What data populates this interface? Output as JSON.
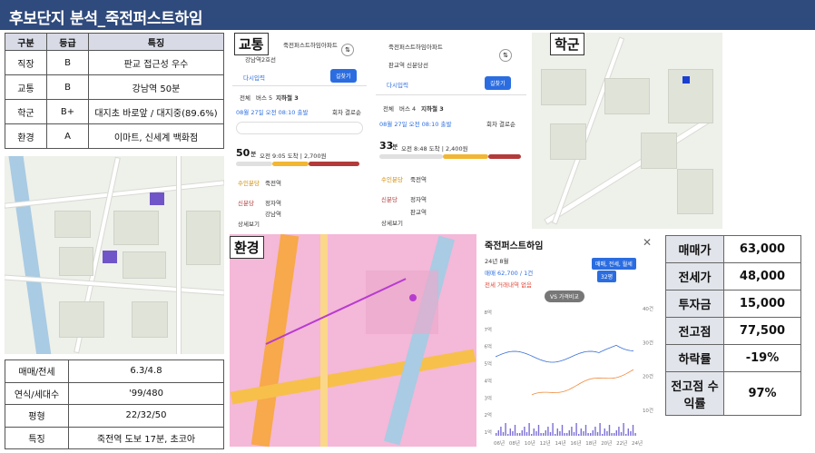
{
  "title": "후보단지 분석_죽전퍼스트하임",
  "grades_table": {
    "headers": [
      "구분",
      "등급",
      "특징"
    ],
    "rows": [
      [
        "직장",
        "B",
        "판교 접근성 우수"
      ],
      [
        "교통",
        "B",
        "강남역 50분"
      ],
      [
        "학군",
        "B+",
        "대지초 바로앞 / 대지중(89.6%)"
      ],
      [
        "환경",
        "A",
        "이마트, 신세계 백화점"
      ]
    ]
  },
  "info_table": {
    "rows": [
      [
        "매매/전세",
        "6.3/4.8"
      ],
      [
        "연식/세대수",
        "'99/480"
      ],
      [
        "평형",
        "22/32/50"
      ],
      [
        "특징",
        "죽전역 도보 17분, 초코아"
      ]
    ]
  },
  "labels": {
    "traffic": "교통",
    "school": "학군",
    "environment": "환경"
  },
  "route1": {
    "from": "죽전퍼스트하임아파트",
    "to": "강남역2호선",
    "reset": "다시입력",
    "go": "길찾기",
    "tabs": [
      "전체",
      "버스 5",
      "지하철 3"
    ],
    "date": "08월 27일 오전 08:10 출발",
    "opts": "회차 결로순",
    "minutes": "50",
    "minutes_unit": "분",
    "detail": "오전 9:05 도착 | 2,700원",
    "steps": [
      "수인분당",
      "죽전역",
      "신분당",
      "정자역",
      "강남역"
    ],
    "more": "상세보기"
  },
  "route2": {
    "from": "죽전퍼스트하임아파트",
    "to": "판교역 신분당선",
    "reset": "다시입력",
    "go": "길찾기",
    "tabs": [
      "전체",
      "버스 4",
      "지하철 3"
    ],
    "date": "08월 27일 오전 08:10 출발",
    "opts": "회차 결로순",
    "minutes": "33",
    "minutes_unit": "분",
    "detail": "오전 8:48 도착 | 2,400원",
    "steps": [
      "수인분당",
      "죽전역",
      "신분당",
      "정자역",
      "판교역"
    ],
    "more": "상세보기"
  },
  "price_panel": {
    "title": "죽전퍼스트하임",
    "month": "24년 8월",
    "sale": "매매 62,700 / 1건",
    "jeonse": "전세 거래내역 없음",
    "filter": "매매, 전세, 월세",
    "size": "32평",
    "compare": "VS 가격비교",
    "x_ticks": [
      "06년",
      "08년",
      "10년",
      "12년",
      "14년",
      "16년",
      "18년",
      "20년",
      "22년",
      "24년"
    ],
    "y_left": [
      "8억",
      "7억",
      "6억",
      "5억",
      "4억",
      "3억",
      "2억",
      "1억"
    ],
    "y_right": [
      "40건",
      "30건",
      "20건",
      "10건"
    ]
  },
  "summary": {
    "rows": [
      [
        "매매가",
        "63,000"
      ],
      [
        "전세가",
        "48,000"
      ],
      [
        "투자금",
        "15,000"
      ],
      [
        "전고점",
        "77,500"
      ],
      [
        "하락률",
        "-19%"
      ],
      [
        "전고점 수익률",
        "97%"
      ]
    ]
  },
  "colors": {
    "header": "#2f4a7c",
    "link": "#2b6de0",
    "sale": "#3a6fd8",
    "jeonse": "#f08a3c"
  }
}
